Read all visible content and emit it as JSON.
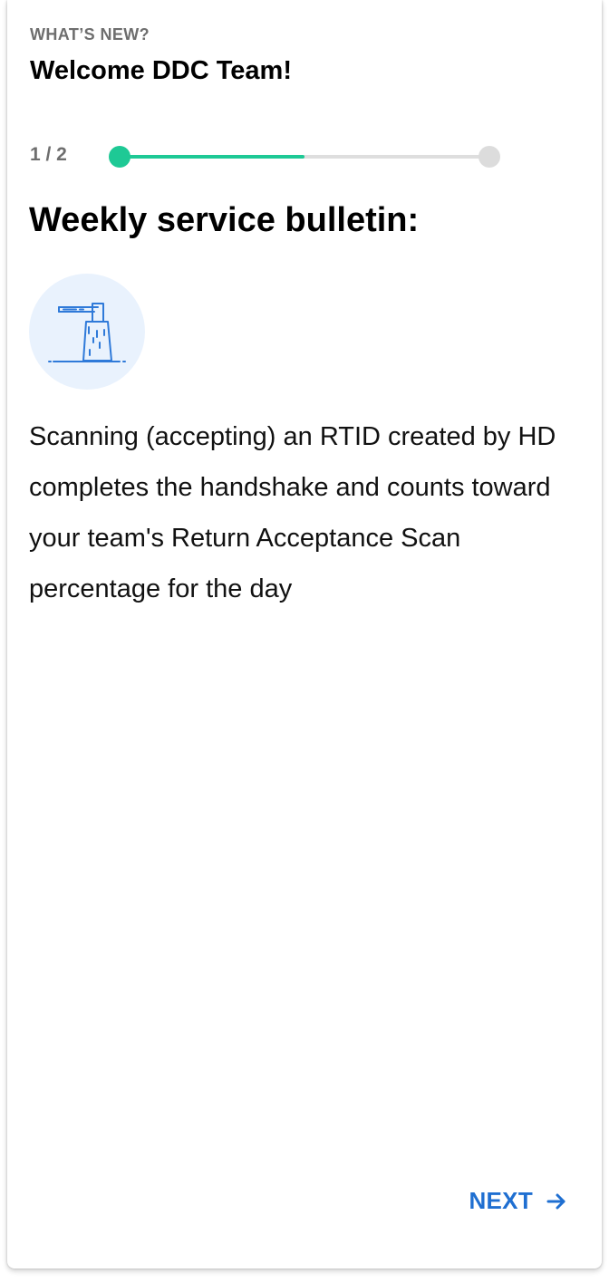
{
  "header": {
    "eyebrow": "WHAT’S NEW?",
    "title": "Welcome DDC Team!"
  },
  "progress": {
    "label": "1 / 2",
    "current": 1,
    "total": 2,
    "fill_fraction": 0.5,
    "active_color": "#1ec995",
    "inactive_color": "#dcdcdc"
  },
  "bulletin": {
    "heading": "Weekly service bulletin:",
    "icon": "scanner-station-icon",
    "body": "Scanning (accepting) an RTID created by HD completes the handshake and counts toward your team's Return Acceptance Scan percentage for the day"
  },
  "footer": {
    "next_label": "NEXT",
    "next_icon": "arrow-right-icon",
    "accent_color": "#1f6fd1"
  }
}
